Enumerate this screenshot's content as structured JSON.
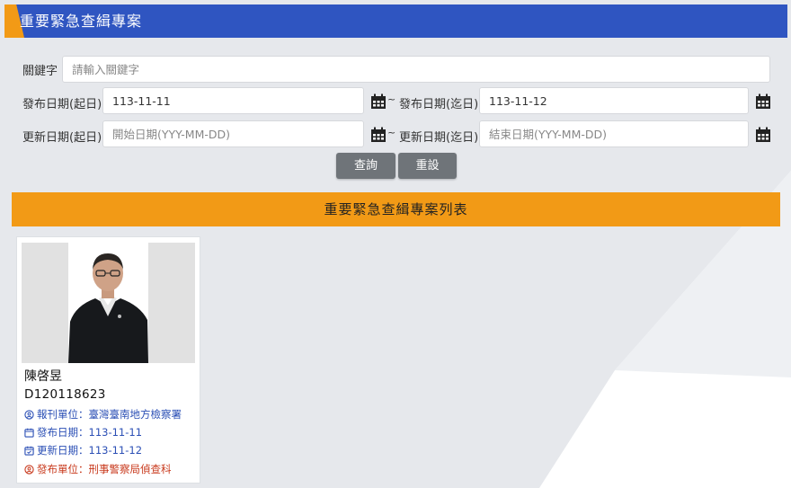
{
  "header": {
    "title": "重要緊急查緝專案"
  },
  "search": {
    "keyword_label": "關鍵字",
    "keyword_placeholder": "請輸入關鍵字",
    "keyword_value": "",
    "publish_start_label": "發布日期(起日)",
    "publish_start_value": "113-11-11",
    "publish_end_label": "發布日期(迄日)",
    "publish_end_value": "113-11-12",
    "update_start_label": "更新日期(起日)",
    "update_start_placeholder": "開始日期(YYY-MM-DD)",
    "update_end_label": "更新日期(迄日)",
    "update_end_placeholder": "結束日期(YYY-MM-DD)",
    "range_separator": "~",
    "query_label": "查詢",
    "reset_label": "重設"
  },
  "list": {
    "title": "重要緊急查緝專案列表",
    "items": [
      {
        "name": "陳啓昱",
        "id_number": "D120118623",
        "issuing_unit": "報刊單位：臺灣臺南地方檢察署",
        "publish_date": "發布日期：113-11-11",
        "update_date": "更新日期：113-11-12",
        "publishing_unit": "發布單位：刑事警察局偵查科"
      }
    ]
  },
  "colors": {
    "header_blue": "#2f55c1",
    "accent_orange": "#f29a16",
    "button_gray": "#6f7479",
    "link_blue": "#2b4fb5",
    "alert_red": "#c8391c"
  }
}
